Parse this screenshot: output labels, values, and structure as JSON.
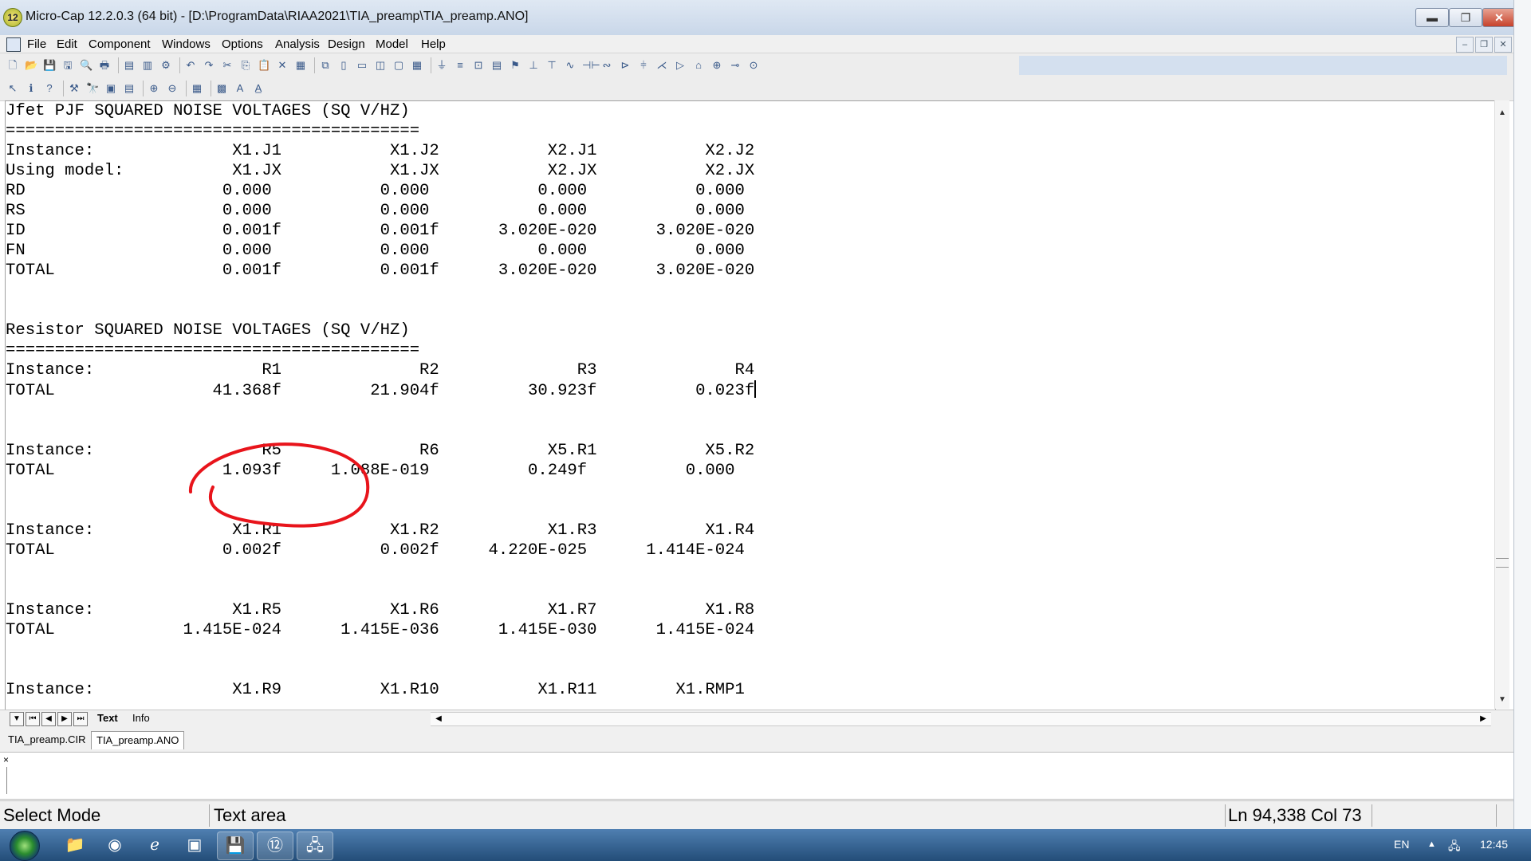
{
  "window": {
    "title": "Micro-Cap 12.2.0.3 (64 bit) - [D:\\ProgramData\\RIAA2021\\TIA_preamp\\TIA_preamp.ANO]",
    "app_icon_glyph": "12",
    "minimize": "▬",
    "maximize": "❐",
    "close": "✕"
  },
  "menu": {
    "items": [
      "File",
      "Edit",
      "Component",
      "Windows",
      "Options",
      "Analysis",
      "Design",
      "Model",
      "Help"
    ],
    "mdi_minimize": "‒",
    "mdi_restore": "❐",
    "mdi_close": "✕"
  },
  "toolbar1": {
    "icons": [
      "new-file-icon",
      "open-folder-icon",
      "save-icon",
      "save-all-icon",
      "print-preview-icon",
      "print-icon",
      "properties-icon",
      "component-icon",
      "layers-icon",
      "undo-icon",
      "redo-icon",
      "cut-icon",
      "copy-icon",
      "paste-icon",
      "delete-icon",
      "select-all-icon",
      "window-cascade-icon",
      "tile-vertical-icon",
      "tile-horizontal-icon",
      "window-split-icon",
      "window-full-icon",
      "calculator-icon",
      "wire-icon",
      "bus-icon",
      "text-icon",
      "grid-text-icon",
      "flag-icon",
      "pin-icon",
      "ground-icon",
      "resistor-icon",
      "capacitor-icon",
      "inductor-icon",
      "diode-icon",
      "battery-icon",
      "npn-icon",
      "opamp-icon",
      "gate-icon",
      "source-icon",
      "switch-icon",
      "meter-icon"
    ],
    "glyphs": [
      "🗋",
      "📂",
      "💾",
      "🖫",
      "🔍",
      "🖶",
      "▤",
      "▥",
      "⚙",
      "↶",
      "↷",
      "✂",
      "⎘",
      "📋",
      "✕",
      "▦",
      "⧉",
      "▯",
      "▭",
      "◫",
      "▢",
      "▦",
      "⏚",
      "≡",
      "⊡",
      "▤",
      "⚑",
      "⊥",
      "⊤",
      "∿",
      "⊣⊢",
      "∾",
      "⊳",
      "⫩",
      "⋌",
      "▷",
      "⌂",
      "⊕",
      "⊸",
      "⊙"
    ]
  },
  "toolbar2": {
    "icons": [
      "select-arrow-icon",
      "info-icon",
      "help-icon",
      "component-edit-icon",
      "find-icon",
      "attribute-icon",
      "display-icon",
      "zoom-in-icon",
      "zoom-out-icon",
      "grid-icon",
      "color-palette-icon",
      "font-icon",
      "text-style-icon"
    ],
    "glyphs": [
      "↖",
      "ℹ",
      "?",
      "⚒",
      "🔭",
      "▣",
      "▤",
      "⊕",
      "⊖",
      "▦",
      "▩",
      "A",
      "A̲"
    ]
  },
  "document": {
    "lines": [
      "Jfet PJF SQUARED NOISE VOLTAGES (SQ V/HZ)",
      "==========================================",
      "Instance:              X1.J1           X1.J2           X2.J1           X2.J2",
      "Using model:           X1.JX           X1.JX           X2.JX           X2.JX",
      "RD                    0.000           0.000           0.000           0.000",
      "RS                    0.000           0.000           0.000           0.000",
      "ID                    0.001f          0.001f      3.020E-020      3.020E-020",
      "FN                    0.000           0.000           0.000           0.000",
      "TOTAL                 0.001f          0.001f      3.020E-020      3.020E-020",
      "",
      "",
      "Resistor SQUARED NOISE VOLTAGES (SQ V/HZ)",
      "==========================================",
      "Instance:                 R1              R2              R3              R4",
      "TOTAL                41.368f         21.904f         30.923f          0.023f",
      "",
      "",
      "Instance:                 R5              R6           X5.R1           X5.R2",
      "TOTAL                 1.093f     1.088E-019          0.249f          0.000",
      "",
      "",
      "Instance:              X1.R1           X1.R2           X1.R3           X1.R4",
      "TOTAL                 0.002f          0.002f     4.220E-025      1.414E-024",
      "",
      "",
      "Instance:              X1.R5           X1.R6           X1.R7           X1.R8",
      "TOTAL             1.415E-024      1.415E-036      1.415E-030      1.415E-024",
      "",
      "",
      "Instance:              X1.R9          X1.R10          X1.R11        X1.RMP1"
    ],
    "cursor_line": 14,
    "annotation_color": "#e8141b"
  },
  "page_tabs": {
    "text": "Text",
    "info": "Info"
  },
  "file_tabs": [
    "TIA_preamp.CIR",
    "TIA_preamp.ANO"
  ],
  "output_pane": {
    "close": "×"
  },
  "status": {
    "mode": "Select Mode",
    "area": "Text area",
    "position": "Ln 94,338 Col 73"
  },
  "taskbar": {
    "apps": [
      {
        "name": "explorer-icon",
        "glyph": "📁"
      },
      {
        "name": "chrome-icon",
        "glyph": "◉"
      },
      {
        "name": "internet-explorer-icon",
        "glyph": "ℯ"
      },
      {
        "name": "store-icon",
        "glyph": "▣"
      },
      {
        "name": "floppy-save-icon",
        "glyph": "💾"
      },
      {
        "name": "microcap-icon",
        "glyph": "⑫"
      },
      {
        "name": "network-drive-icon",
        "glyph": "🖧"
      }
    ],
    "language": "EN",
    "clock": "12:45"
  },
  "colors": {
    "titlebar": "#c9d7e9",
    "taskbar": "#234d78",
    "annotation": "#e8141b"
  }
}
